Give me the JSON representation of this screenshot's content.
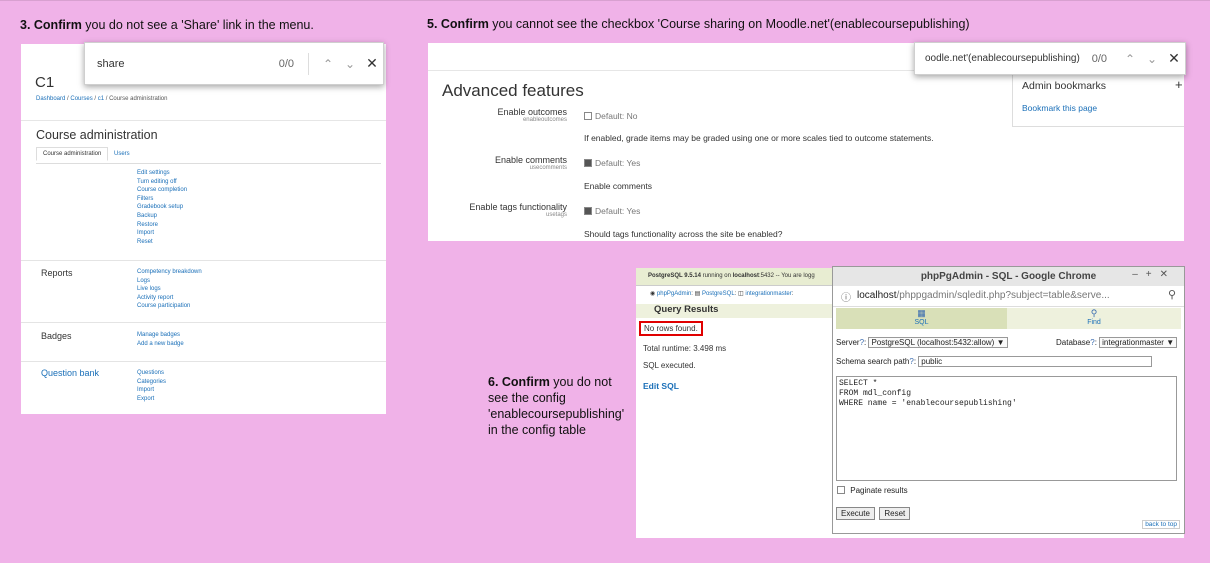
{
  "captions": {
    "step3_num": "3. Confirm",
    "step3_text": "you do not see a 'Share' link in the menu.",
    "step5_num": "5. Confirm",
    "step5_text": "you cannot see the checkbox 'Course sharing on Moodle.net'(enablecoursepublishing)",
    "step6_num": "6. Confirm",
    "step6_line1": "you do not",
    "step6_line2": "see the config",
    "step6_line3": "'enablecoursepublishing'",
    "step6_line4": "in the config table"
  },
  "panel1": {
    "find": {
      "query": "share",
      "count": "0/0"
    },
    "course_title": "C1",
    "breadcrumb": [
      "Dashboard",
      "Courses",
      "c1",
      "Course administration"
    ],
    "heading": "Course administration",
    "tabs": [
      "Course administration",
      "Users"
    ],
    "course_links": [
      "Edit settings",
      "Turn editing off",
      "Course completion",
      "Filters",
      "Gradebook setup",
      "Backup",
      "Restore",
      "Import",
      "Reset"
    ],
    "reports_label": "Reports",
    "reports_links": [
      "Competency breakdown",
      "Logs",
      "Live logs",
      "Activity report",
      "Course participation"
    ],
    "badges_label": "Badges",
    "badges_links": [
      "Manage badges",
      "Add a new badge"
    ],
    "qbank_label": "Question bank",
    "qbank_links": [
      "Questions",
      "Categories",
      "Import",
      "Export"
    ]
  },
  "panel2": {
    "find": {
      "query": "oodle.net'(enablecoursepublishing)",
      "count": "0/0"
    },
    "heading": "Advanced features",
    "settings": [
      {
        "label": "Enable outcomes",
        "key": "enableoutcomes",
        "default": "Default: No",
        "checked": false,
        "desc": "If enabled, grade items may be graded using one or more scales tied to outcome statements."
      },
      {
        "label": "Enable comments",
        "key": "usecomments",
        "default": "Default: Yes",
        "checked": true,
        "desc": "Enable comments"
      },
      {
        "label": "Enable tags functionality",
        "key": "usetags",
        "default": "Default: Yes",
        "checked": true,
        "desc": "Should tags functionality across the site be enabled?"
      }
    ],
    "admin_bookmarks": "Admin bookmarks",
    "bookmark_link": "Bookmark this page",
    "plus_icon": "+"
  },
  "pgadmin": {
    "status_version": "PostgreSQL 9.5.14",
    "status_running": "running on",
    "status_host": "localhost",
    "status_port": ":5432 -- You are logg",
    "trail": [
      "phpPgAdmin",
      "PostgreSQL",
      "integrationmaster"
    ],
    "query_results": "Query Results",
    "no_rows": "No rows found.",
    "runtime": "Total runtime: 3.498 ms",
    "executed": "SQL executed.",
    "edit_sql": "Edit SQL"
  },
  "chrome": {
    "title": "phpPgAdmin - SQL - Google Chrome",
    "url_host": "localhost",
    "url_path": "/phppgadmin/sqledit.php?subject=table&serve...",
    "tab_sql": "SQL",
    "tab_find": "Find",
    "server_label": "Server",
    "server_value": "PostgreSQL (localhost:5432:allow)",
    "database_label": "Database",
    "database_value": "integrationmaster",
    "schema_label": "Schema search path",
    "schema_value": "public",
    "sql_line1": "SELECT *",
    "sql_line2": "FROM mdl_config",
    "sql_line3": "WHERE name = 'enablecoursepublishing'",
    "paginate_label": "Paginate results",
    "execute": "Execute",
    "reset": "Reset",
    "back_to_top": "back to top"
  }
}
